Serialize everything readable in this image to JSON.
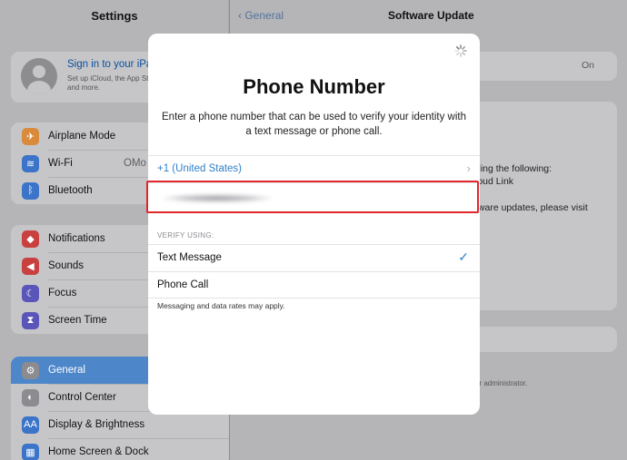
{
  "sidebar": {
    "title": "Settings",
    "profile": {
      "title": "Sign in to your iPad",
      "subtitle": "Set up iCloud, the App Store, and more."
    },
    "group1": [
      {
        "label": "Airplane Mode",
        "icon": "airplane-icon",
        "color": "#d98a3a",
        "glyph": "✈",
        "value": ""
      },
      {
        "label": "Wi-Fi",
        "icon": "wifi-icon",
        "color": "#3b74c8",
        "glyph": "≋",
        "value": "OMo"
      },
      {
        "label": "Bluetooth",
        "icon": "bluetooth-icon",
        "color": "#3b74c8",
        "glyph": "ᛒ",
        "value": ""
      }
    ],
    "group2": [
      {
        "label": "Notifications",
        "icon": "bell-icon",
        "color": "#c9413f",
        "glyph": "◆"
      },
      {
        "label": "Sounds",
        "icon": "speaker-icon",
        "color": "#c9413f",
        "glyph": "◀"
      },
      {
        "label": "Focus",
        "icon": "moon-icon",
        "color": "#5a55b8",
        "glyph": "☾"
      },
      {
        "label": "Screen Time",
        "icon": "hourglass-icon",
        "color": "#5a55b8",
        "glyph": "⧗"
      }
    ],
    "group3": [
      {
        "label": "General",
        "icon": "gear-icon",
        "color": "#8b8b90",
        "glyph": "⚙"
      },
      {
        "label": "Control Center",
        "icon": "toggles-icon",
        "color": "#8b8b90",
        "glyph": "◐"
      },
      {
        "label": "Display & Brightness",
        "icon": "text-size-icon",
        "color": "#3b74c8",
        "glyph": "AA"
      },
      {
        "label": "Home Screen & Dock",
        "icon": "grid-icon",
        "color": "#3b74c8",
        "glyph": "▦"
      }
    ]
  },
  "detail": {
    "back_label": "General",
    "title": "Software Update",
    "toggle_value": "On",
    "text1": "ding the following:",
    "text2": "loud Link",
    "text3": "tware updates, please visit",
    "text4": "ur administrator."
  },
  "modal": {
    "title": "Phone Number",
    "description": "Enter a phone number that can be used to verify your identity with a text message or phone call.",
    "country": "+1 (United States)",
    "verify_label": "VERIFY USING:",
    "option_text": "Text Message",
    "option_call": "Phone Call",
    "selected_option": "Text Message",
    "footnote": "Messaging and data rates may apply."
  },
  "colors": {
    "accent": "#2f7fc8",
    "highlight": "#e3262b"
  }
}
